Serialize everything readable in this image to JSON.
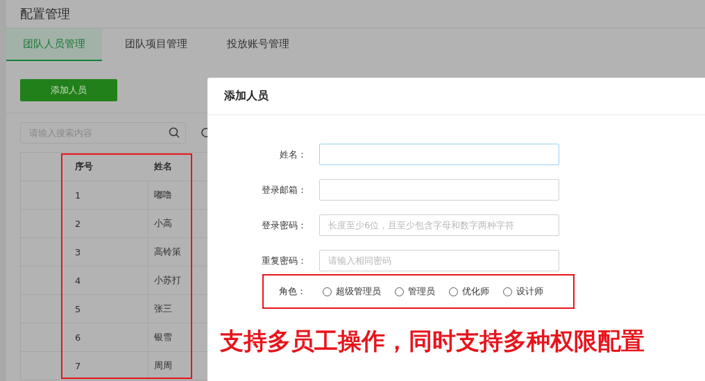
{
  "page_title": "配置管理",
  "tabs": [
    {
      "label": "团队人员管理",
      "selected": true
    },
    {
      "label": "团队项目管理",
      "selected": false
    },
    {
      "label": "投放账号管理",
      "selected": false
    }
  ],
  "add_button": "添加人员",
  "search": {
    "placeholder": "请输入搜索内容"
  },
  "table": {
    "columns": [
      "序号",
      "姓名"
    ],
    "rows": [
      {
        "index": "1",
        "name": "嘟噜"
      },
      {
        "index": "2",
        "name": "小高"
      },
      {
        "index": "3",
        "name": "高铃策"
      },
      {
        "index": "4",
        "name": "小苏打"
      },
      {
        "index": "5",
        "name": "张三"
      },
      {
        "index": "6",
        "name": "银雪"
      },
      {
        "index": "7",
        "name": "周周"
      }
    ]
  },
  "dialog": {
    "title": "添加人员",
    "fields": [
      {
        "label": "姓名：",
        "focused": true
      },
      {
        "label": "登录邮箱：",
        "focused": false
      },
      {
        "label": "登录密码：",
        "placeholder": "长度至少6位，且至少包含字母和数字两种字符",
        "focused": false
      },
      {
        "label": "重复密码：",
        "placeholder": "请输入相同密码",
        "focused": false
      }
    ],
    "role": {
      "label": "角色：",
      "options": [
        {
          "label": "超级管理员",
          "selected": false
        },
        {
          "label": "管理员",
          "selected": false
        },
        {
          "label": "优化师",
          "selected": false
        },
        {
          "label": "设计师",
          "selected": false
        }
      ]
    }
  },
  "annotation": "支持多员工操作，同时支持多种权限配置"
}
